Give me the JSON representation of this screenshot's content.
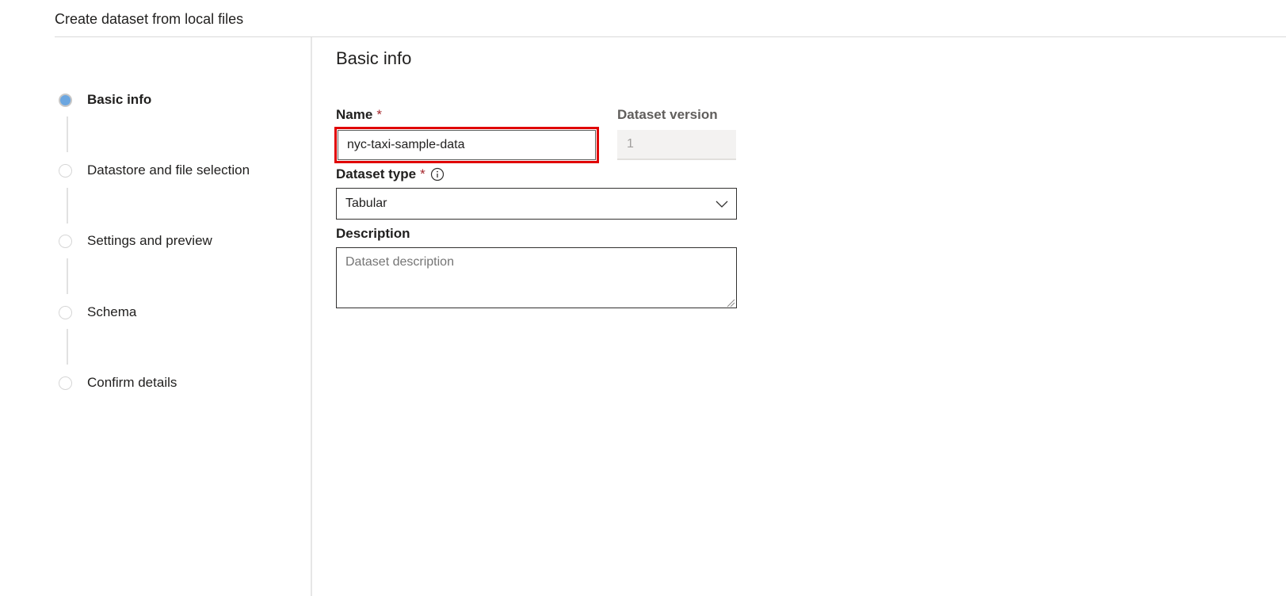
{
  "wizard": {
    "title": "Create dataset from local files"
  },
  "steps": [
    {
      "label": "Basic info",
      "active": true
    },
    {
      "label": "Datastore and file selection",
      "active": false
    },
    {
      "label": "Settings and preview",
      "active": false
    },
    {
      "label": "Schema",
      "active": false
    },
    {
      "label": "Confirm details",
      "active": false
    }
  ],
  "form": {
    "section_title": "Basic info",
    "name": {
      "label": "Name",
      "required_mark": "*",
      "value": "nyc-taxi-sample-data"
    },
    "version": {
      "label": "Dataset version",
      "value": "1"
    },
    "dataset_type": {
      "label": "Dataset type",
      "required_mark": "*",
      "info_icon": "info-icon",
      "selected": "Tabular",
      "dropdown_icon": "chevron-down-icon"
    },
    "description": {
      "label": "Description",
      "placeholder": "Dataset description"
    }
  },
  "colors": {
    "active_step": "#6ba6e0",
    "highlight_border": "#e00000",
    "required": "#a4262c"
  }
}
